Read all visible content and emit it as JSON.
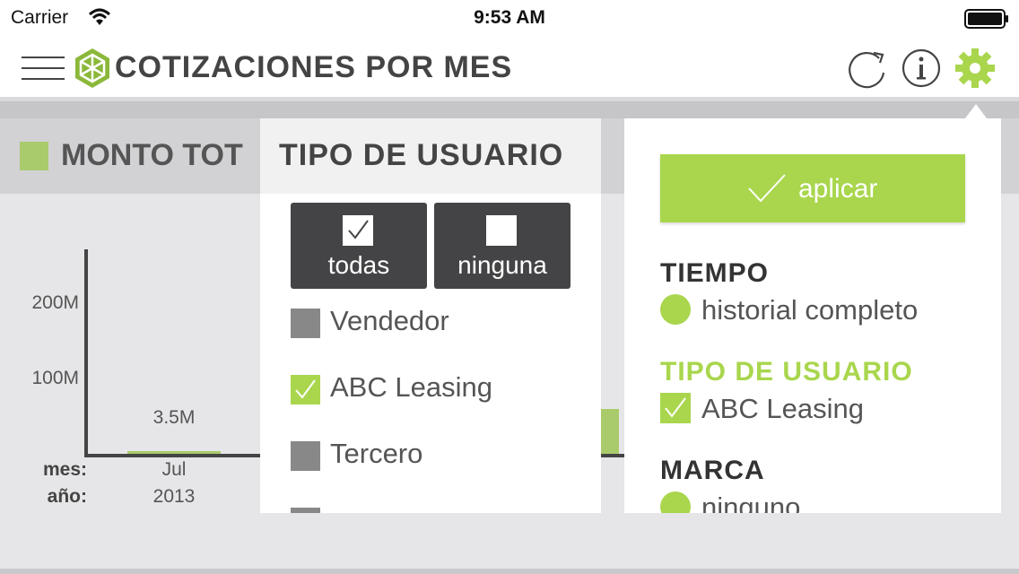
{
  "status_bar": {
    "carrier": "Carrier",
    "time": "9:53 AM"
  },
  "header": {
    "title": "COTIZACIONES POR MES"
  },
  "legend": {
    "label": "MONTO TOT"
  },
  "chart_data": {
    "type": "bar",
    "y_tick_labels": [
      "200M",
      "100M"
    ],
    "x_axis_keys": {
      "month": "mes:",
      "year": "año:"
    },
    "categories": [
      {
        "month": "Jul",
        "year": "2013"
      }
    ],
    "values": [
      3500000
    ],
    "data_labels": [
      "3.5M"
    ],
    "partial_bar_visible": true
  },
  "colors": {
    "accent": "#a9d64d",
    "bar": "#a9cb6b",
    "dark": "#444446"
  },
  "filter_panel": {
    "title": "TIPO DE USUARIO",
    "select_all": "todas",
    "select_none": "ninguna",
    "options": [
      {
        "label": "Vendedor",
        "checked": false
      },
      {
        "label": "ABC Leasing",
        "checked": true
      },
      {
        "label": "Tercero",
        "checked": false
      }
    ]
  },
  "summary_panel": {
    "apply_label": "aplicar",
    "sections": [
      {
        "heading": "TIEMPO",
        "value": "historial completo",
        "marker": "dot"
      },
      {
        "heading": "TIPO DE USUARIO",
        "value": "ABC Leasing",
        "marker": "check"
      },
      {
        "heading": "MARCA",
        "value": "ninguno",
        "marker": "dot"
      }
    ]
  }
}
